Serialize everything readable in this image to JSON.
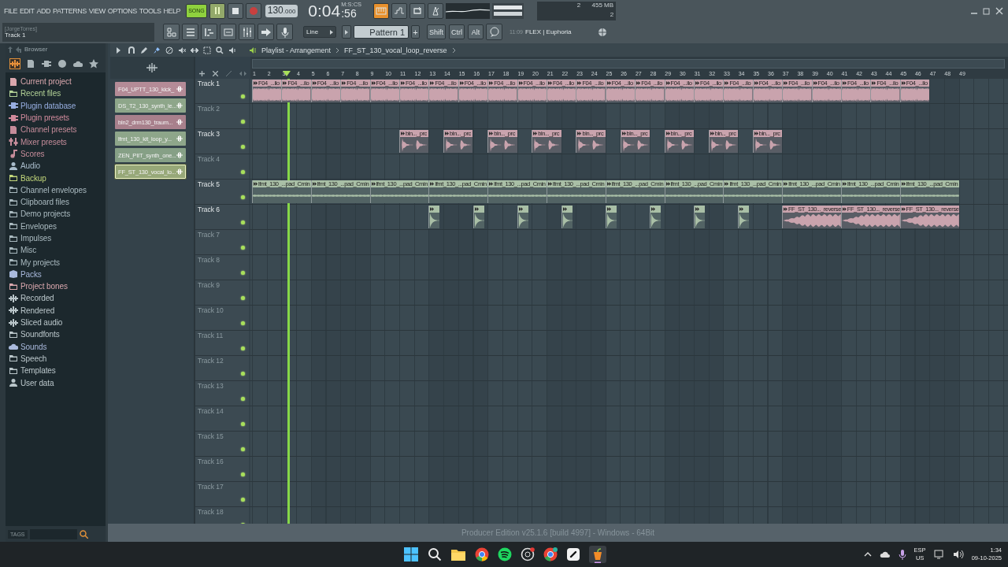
{
  "menu": [
    "FILE",
    "EDIT",
    "ADD",
    "PATTERNS",
    "VIEW",
    "OPTIONS",
    "TOOLS",
    "HELP"
  ],
  "transport": {
    "mode": "SONG",
    "song_mode": true,
    "playing": true,
    "recording": false,
    "tempo": "130",
    "tempo_decimals": ".000",
    "time": "0:04",
    "time_cs": ":56",
    "time_unit": "M:S:CS"
  },
  "toggles": [
    {
      "on": true
    },
    {
      "on": false
    },
    {
      "on": false
    },
    {
      "on": false
    }
  ],
  "monitor": {
    "cpu": "2",
    "memory": "455 MB",
    "polyphony": "2"
  },
  "hint": {
    "title": "[JorgeTorres]",
    "text": "Track 1"
  },
  "toolbar": {
    "snap": "Line",
    "pattern": "Pattern 1",
    "pattern_add": "+",
    "modifiers": [
      "Shift",
      "Ctrl",
      "Alt"
    ],
    "news_time": "11:09",
    "news_title": "FLEX | Euphoria"
  },
  "browser": {
    "title": "Browser",
    "tags_label": "TAGS",
    "items": [
      {
        "label": "Current project",
        "color": "#d9a7ad"
      },
      {
        "label": "Recent files",
        "color": "#b2d196"
      },
      {
        "label": "Plugin database",
        "color": "#97aee0"
      },
      {
        "label": "Plugin presets",
        "color": "#d08a9c"
      },
      {
        "label": "Channel presets",
        "color": "#c58c9a"
      },
      {
        "label": "Mixer presets",
        "color": "#c58c9a"
      },
      {
        "label": "Scores",
        "color": "#c58c9a"
      },
      {
        "label": "Audio",
        "color": "#a9bccb"
      },
      {
        "label": "Backup",
        "color": "#c2d67a"
      },
      {
        "label": "Channel envelopes",
        "color": "#a9b9bf"
      },
      {
        "label": "Clipboard files",
        "color": "#a9b9bf"
      },
      {
        "label": "Demo projects",
        "color": "#a9b9bf"
      },
      {
        "label": "Envelopes",
        "color": "#a9b9bf"
      },
      {
        "label": "Impulses",
        "color": "#a9b9bf"
      },
      {
        "label": "Misc",
        "color": "#a9b9bf"
      },
      {
        "label": "My projects",
        "color": "#a9b9bf"
      },
      {
        "label": "Packs",
        "color": "#a9b9dc"
      },
      {
        "label": "Project bones",
        "color": "#d9a7ad"
      },
      {
        "label": "Recorded",
        "color": "#bac6ca"
      },
      {
        "label": "Rendered",
        "color": "#bac6ca"
      },
      {
        "label": "Sliced audio",
        "color": "#bac6ca"
      },
      {
        "label": "Soundfonts",
        "color": "#bac6ca"
      },
      {
        "label": "Sounds",
        "color": "#a9b9dc"
      },
      {
        "label": "Speech",
        "color": "#bac6ca"
      },
      {
        "label": "Templates",
        "color": "#bac6ca"
      },
      {
        "label": "User data",
        "color": "#bac6ca"
      }
    ]
  },
  "picker": [
    {
      "label": "F04_UPTT_130_kick_",
      "color": "#b48b97",
      "selected": false
    },
    {
      "label": "DS_T2_130_synth_le...",
      "color": "#8ea68a",
      "selected": false
    },
    {
      "label": "bln2_drm130_traum...",
      "color": "#a8808c",
      "selected": false
    },
    {
      "label": "lfmt_130_kit_loop_y...",
      "color": "#8ea68a",
      "selected": false
    },
    {
      "label": "ZEN_PIIT_synth_one...",
      "color": "#86a086",
      "selected": false
    },
    {
      "label": "FF_ST_130_vocal_lo...",
      "color": "#97a878",
      "selected": true
    }
  ],
  "playlist": {
    "title": "Playlist - Arrangement",
    "pattern": "FF_ST_130_vocal_loop_reverse",
    "ruler": [
      "1",
      "2",
      "3",
      "4",
      "5",
      "6",
      "7",
      "8",
      "9",
      "10",
      "11",
      "12",
      "13",
      "14",
      "15",
      "16",
      "17",
      "18",
      "19",
      "20",
      "21",
      "22",
      "23",
      "24",
      "25",
      "26",
      "27",
      "28",
      "29",
      "30",
      "31",
      "32",
      "33",
      "34",
      "35",
      "36",
      "37",
      "38",
      "39",
      "40",
      "41",
      "42",
      "43",
      "44",
      "45",
      "46",
      "47",
      "48",
      "49"
    ],
    "playhead": {
      "level": 0.048
    },
    "tracks": [
      {
        "name": "Track 1",
        "empty": false,
        "enabled": true,
        "clips": [
          {
            "label": "F04_...ilo",
            "color": "#c9a3ad",
            "kind": "loop"
          },
          {
            "label": "F04_...ilo",
            "color": "#c9a3ad",
            "kind": "loop"
          },
          {
            "label": "F04_...ilo",
            "color": "#c9a3ad",
            "kind": "loop"
          },
          {
            "label": "F04_...ilo",
            "color": "#c9a3ad",
            "kind": "loop"
          },
          {
            "label": "F04_...ilo",
            "color": "#c9a3ad",
            "kind": "loop"
          },
          {
            "label": "F04_...ilo",
            "color": "#c9a3ad",
            "kind": "loop"
          },
          {
            "label": "F04_...ilo",
            "color": "#c9a3ad",
            "kind": "loop"
          },
          {
            "label": "F04_...ilo",
            "color": "#c9a3ad",
            "kind": "loop"
          },
          {
            "label": "F04_...ilo",
            "color": "#c9a3ad",
            "kind": "loop"
          },
          {
            "label": "F04_...ilo",
            "color": "#c9a3ad",
            "kind": "loop"
          },
          {
            "label": "F04_...ilo",
            "color": "#c9a3ad",
            "kind": "loop"
          },
          {
            "label": "F04_...ilo",
            "color": "#c9a3ad",
            "kind": "loop"
          },
          {
            "label": "F04_...ilo",
            "color": "#c9a3ad",
            "kind": "loop"
          },
          {
            "label": "F04_...ilo",
            "color": "#c9a3ad",
            "kind": "loop"
          },
          {
            "label": "F04_...ilo",
            "color": "#c9a3ad",
            "kind": "loop"
          },
          {
            "label": "F04_...ilo",
            "color": "#c9a3ad",
            "kind": "loop"
          },
          {
            "label": "F04_...ilo",
            "color": "#c9a3ad",
            "kind": "loop"
          },
          {
            "label": "F04_...ilo",
            "color": "#c9a3ad",
            "kind": "loop"
          },
          {
            "label": "F04_...ilo",
            "color": "#c9a3ad",
            "kind": "loop"
          },
          {
            "label": "F04_...ilo",
            "color": "#c9a3ad",
            "kind": "loop"
          },
          {
            "label": "F04_...ilo",
            "color": "#c9a3ad",
            "kind": "loop"
          },
          {
            "label": "F04_...ilo",
            "color": "#c9a3ad",
            "kind": "loop"
          },
          {
            "label": "F04_...ilo",
            "color": "#c9a3ad",
            "kind": "loop"
          }
        ]
      },
      {
        "name": "Track 2",
        "empty": true,
        "enabled": true
      },
      {
        "name": "Track 3",
        "empty": false,
        "enabled": true,
        "clips": [
          {
            "label": "bln..._prc",
            "color": "#c9a3ad",
            "kind": "hits"
          },
          {
            "label": "bln..._prc",
            "color": "#c9a3ad",
            "kind": "hits"
          },
          {
            "label": "bln..._prc",
            "color": "#c9a3ad",
            "kind": "hits"
          },
          {
            "label": "bln..._prc",
            "color": "#c9a3ad",
            "kind": "hits"
          },
          {
            "label": "bln..._prc",
            "color": "#c9a3ad",
            "kind": "hits"
          },
          {
            "label": "bln..._prc",
            "color": "#c9a3ad",
            "kind": "hits"
          },
          {
            "label": "bln..._prc",
            "color": "#c9a3ad",
            "kind": "hits"
          },
          {
            "label": "bln..._prc",
            "color": "#c9a3ad",
            "kind": "hits"
          },
          {
            "label": "bln..._prc",
            "color": "#c9a3ad",
            "kind": "hits"
          }
        ]
      },
      {
        "name": "Track 4",
        "empty": true,
        "enabled": true
      },
      {
        "name": "Track 5",
        "empty": false,
        "enabled": true,
        "clips": [
          {
            "label": "lfmt_130_...pad_Cmin",
            "color": "#a9bfa6",
            "kind": "pad"
          },
          {
            "label": "lfmt_130_...pad_Cmin",
            "color": "#a9bfa6",
            "kind": "pad"
          },
          {
            "label": "lfmt_130_...pad_Cmin",
            "color": "#a9bfa6",
            "kind": "pad"
          },
          {
            "label": "lfmt_130_...pad_Cmin",
            "color": "#a9bfa6",
            "kind": "pad"
          },
          {
            "label": "lfmt_130_...pad_Cmin",
            "color": "#a9bfa6",
            "kind": "pad"
          },
          {
            "label": "lfmt_130_...pad_Cmin",
            "color": "#a9bfa6",
            "kind": "pad"
          },
          {
            "label": "lfmt_130_...pad_Cmin",
            "color": "#a9bfa6",
            "kind": "pad"
          },
          {
            "label": "lfmt_130_...pad_Cmin",
            "color": "#a9bfa6",
            "kind": "pad"
          },
          {
            "label": "lfmt_130_...pad_Cmin",
            "color": "#a9bfa6",
            "kind": "pad"
          },
          {
            "label": "lfmt_130_...pad_Cmin",
            "color": "#a9bfa6",
            "kind": "pad"
          },
          {
            "label": "lfmt_130_...pad_Cmin",
            "color": "#a9bfa6",
            "kind": "pad"
          },
          {
            "label": "lfmt_130_...pad_Cmin",
            "color": "#a9bfa6",
            "kind": "pad"
          }
        ]
      },
      {
        "name": "Track 6",
        "empty": false,
        "enabled": true,
        "clips": [
          {
            "color": "#a9bfa6",
            "kind": "shot"
          },
          {
            "color": "#a9bfa6",
            "kind": "shot"
          },
          {
            "color": "#a9bfa6",
            "kind": "shot"
          },
          {
            "color": "#a9bfa6",
            "kind": "shot"
          },
          {
            "color": "#a9bfa6",
            "kind": "shot"
          },
          {
            "color": "#a9bfa6",
            "kind": "shot"
          },
          {
            "color": "#a9bfa6",
            "kind": "shot"
          },
          {
            "color": "#a9bfa6",
            "kind": "shot"
          },
          {
            "label": "FF_ST_130..._reverse",
            "color": "#c9a3ad",
            "kind": "reverse"
          },
          {
            "label": "FF_ST_130..._reverse",
            "color": "#c9a3ad",
            "kind": "reverse"
          },
          {
            "label": "FF_ST_130..._reverse",
            "color": "#c9a3ad",
            "kind": "reverse"
          }
        ]
      },
      {
        "name": "Track 7",
        "empty": true,
        "enabled": true
      },
      {
        "name": "Track 8",
        "empty": true,
        "enabled": true
      },
      {
        "name": "Track 9",
        "empty": true,
        "enabled": true
      },
      {
        "name": "Track 10",
        "empty": true,
        "enabled": true
      },
      {
        "name": "Track 11",
        "empty": true,
        "enabled": true
      },
      {
        "name": "Track 12",
        "empty": true,
        "enabled": true
      },
      {
        "name": "Track 13",
        "empty": true,
        "enabled": true
      },
      {
        "name": "Track 14",
        "empty": true,
        "enabled": true
      },
      {
        "name": "Track 15",
        "empty": true,
        "enabled": true
      },
      {
        "name": "Track 16",
        "empty": true,
        "enabled": true
      },
      {
        "name": "Track 17",
        "empty": true,
        "enabled": true
      },
      {
        "name": "Track 18",
        "empty": true,
        "enabled": true
      }
    ]
  },
  "status": "Producer Edition v25.1.6 [build 4997] - Windows - 64Bit",
  "taskbar": {
    "lang": "ESP",
    "layout": "US",
    "time": "1:34",
    "date": "09-10-2025"
  }
}
